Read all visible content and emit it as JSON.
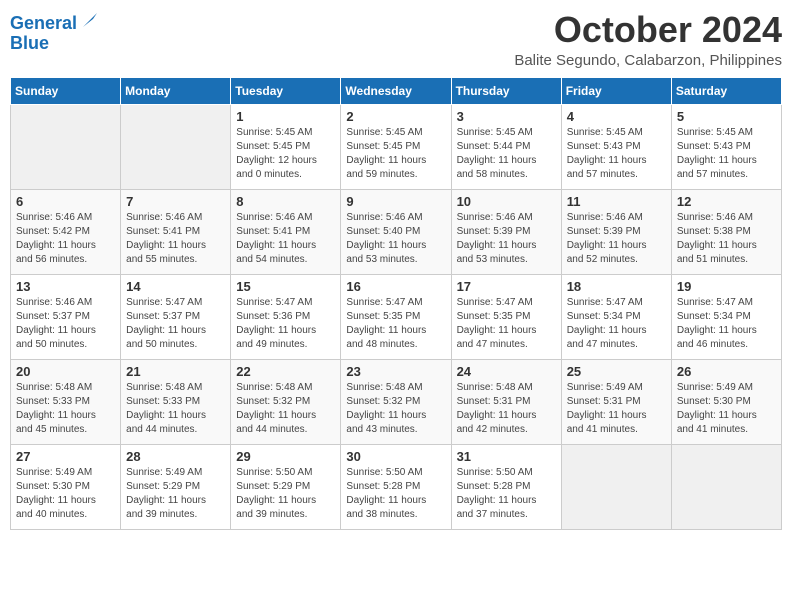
{
  "logo": {
    "line1": "General",
    "line2": "Blue"
  },
  "title": "October 2024",
  "location": "Balite Segundo, Calabarzon, Philippines",
  "days_of_week": [
    "Sunday",
    "Monday",
    "Tuesday",
    "Wednesday",
    "Thursday",
    "Friday",
    "Saturday"
  ],
  "weeks": [
    [
      {
        "day": "",
        "info": ""
      },
      {
        "day": "",
        "info": ""
      },
      {
        "day": "1",
        "info": "Sunrise: 5:45 AM\nSunset: 5:45 PM\nDaylight: 12 hours\nand 0 minutes."
      },
      {
        "day": "2",
        "info": "Sunrise: 5:45 AM\nSunset: 5:45 PM\nDaylight: 11 hours\nand 59 minutes."
      },
      {
        "day": "3",
        "info": "Sunrise: 5:45 AM\nSunset: 5:44 PM\nDaylight: 11 hours\nand 58 minutes."
      },
      {
        "day": "4",
        "info": "Sunrise: 5:45 AM\nSunset: 5:43 PM\nDaylight: 11 hours\nand 57 minutes."
      },
      {
        "day": "5",
        "info": "Sunrise: 5:45 AM\nSunset: 5:43 PM\nDaylight: 11 hours\nand 57 minutes."
      }
    ],
    [
      {
        "day": "6",
        "info": "Sunrise: 5:46 AM\nSunset: 5:42 PM\nDaylight: 11 hours\nand 56 minutes."
      },
      {
        "day": "7",
        "info": "Sunrise: 5:46 AM\nSunset: 5:41 PM\nDaylight: 11 hours\nand 55 minutes."
      },
      {
        "day": "8",
        "info": "Sunrise: 5:46 AM\nSunset: 5:41 PM\nDaylight: 11 hours\nand 54 minutes."
      },
      {
        "day": "9",
        "info": "Sunrise: 5:46 AM\nSunset: 5:40 PM\nDaylight: 11 hours\nand 53 minutes."
      },
      {
        "day": "10",
        "info": "Sunrise: 5:46 AM\nSunset: 5:39 PM\nDaylight: 11 hours\nand 53 minutes."
      },
      {
        "day": "11",
        "info": "Sunrise: 5:46 AM\nSunset: 5:39 PM\nDaylight: 11 hours\nand 52 minutes."
      },
      {
        "day": "12",
        "info": "Sunrise: 5:46 AM\nSunset: 5:38 PM\nDaylight: 11 hours\nand 51 minutes."
      }
    ],
    [
      {
        "day": "13",
        "info": "Sunrise: 5:46 AM\nSunset: 5:37 PM\nDaylight: 11 hours\nand 50 minutes."
      },
      {
        "day": "14",
        "info": "Sunrise: 5:47 AM\nSunset: 5:37 PM\nDaylight: 11 hours\nand 50 minutes."
      },
      {
        "day": "15",
        "info": "Sunrise: 5:47 AM\nSunset: 5:36 PM\nDaylight: 11 hours\nand 49 minutes."
      },
      {
        "day": "16",
        "info": "Sunrise: 5:47 AM\nSunset: 5:35 PM\nDaylight: 11 hours\nand 48 minutes."
      },
      {
        "day": "17",
        "info": "Sunrise: 5:47 AM\nSunset: 5:35 PM\nDaylight: 11 hours\nand 47 minutes."
      },
      {
        "day": "18",
        "info": "Sunrise: 5:47 AM\nSunset: 5:34 PM\nDaylight: 11 hours\nand 47 minutes."
      },
      {
        "day": "19",
        "info": "Sunrise: 5:47 AM\nSunset: 5:34 PM\nDaylight: 11 hours\nand 46 minutes."
      }
    ],
    [
      {
        "day": "20",
        "info": "Sunrise: 5:48 AM\nSunset: 5:33 PM\nDaylight: 11 hours\nand 45 minutes."
      },
      {
        "day": "21",
        "info": "Sunrise: 5:48 AM\nSunset: 5:33 PM\nDaylight: 11 hours\nand 44 minutes."
      },
      {
        "day": "22",
        "info": "Sunrise: 5:48 AM\nSunset: 5:32 PM\nDaylight: 11 hours\nand 44 minutes."
      },
      {
        "day": "23",
        "info": "Sunrise: 5:48 AM\nSunset: 5:32 PM\nDaylight: 11 hours\nand 43 minutes."
      },
      {
        "day": "24",
        "info": "Sunrise: 5:48 AM\nSunset: 5:31 PM\nDaylight: 11 hours\nand 42 minutes."
      },
      {
        "day": "25",
        "info": "Sunrise: 5:49 AM\nSunset: 5:31 PM\nDaylight: 11 hours\nand 41 minutes."
      },
      {
        "day": "26",
        "info": "Sunrise: 5:49 AM\nSunset: 5:30 PM\nDaylight: 11 hours\nand 41 minutes."
      }
    ],
    [
      {
        "day": "27",
        "info": "Sunrise: 5:49 AM\nSunset: 5:30 PM\nDaylight: 11 hours\nand 40 minutes."
      },
      {
        "day": "28",
        "info": "Sunrise: 5:49 AM\nSunset: 5:29 PM\nDaylight: 11 hours\nand 39 minutes."
      },
      {
        "day": "29",
        "info": "Sunrise: 5:50 AM\nSunset: 5:29 PM\nDaylight: 11 hours\nand 39 minutes."
      },
      {
        "day": "30",
        "info": "Sunrise: 5:50 AM\nSunset: 5:28 PM\nDaylight: 11 hours\nand 38 minutes."
      },
      {
        "day": "31",
        "info": "Sunrise: 5:50 AM\nSunset: 5:28 PM\nDaylight: 11 hours\nand 37 minutes."
      },
      {
        "day": "",
        "info": ""
      },
      {
        "day": "",
        "info": ""
      }
    ]
  ]
}
